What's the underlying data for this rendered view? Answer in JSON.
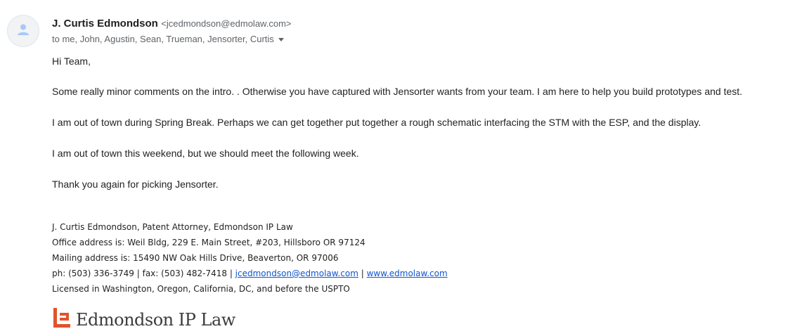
{
  "email": {
    "sender_name": "J. Curtis Edmondson",
    "sender_email": "<jcedmondson@edmolaw.com>",
    "recipients": "to me, John, Agustin, Sean, Trueman, Jensorter, Curtis",
    "body": {
      "greeting": "Hi Team,",
      "paragraphs": [
        "Some really minor comments on the intro. . Otherwise you have captured with Jensorter wants from your team.  I am here to help you build prototypes and test.",
        "I am out of town during Spring Break.  Perhaps we can get together put together a rough schematic interfacing the STM with the ESP, and the display.",
        "I am out of town this weekend, but we should meet the following week.",
        "Thank you again for picking Jensorter."
      ]
    },
    "signature": {
      "line1": "J. Curtis Edmondson, Patent Attorney, Edmondson IP Law",
      "line2": "Office address is: Weil Bldg, 229 E. Main Street, #203, Hillsboro OR 97124",
      "line3": "Mailing address is: 15490 NW Oak Hills Drive, Beaverton, OR 97006",
      "line4_prefix": "ph: (503) 336-3749 | fax: (503) 482-7418 | ",
      "email_link": "jcedmondson@edmolaw.com",
      "separator": " | ",
      "website_link": "www.edmolaw.com",
      "line5": "Licensed in Washington, Oregon, California, DC, and before the USPTO",
      "logo_text": "Edmondson IP Law"
    }
  },
  "colors": {
    "link": "#1155cc",
    "logo_accent": "#e2522c",
    "avatar_bg": "#f1f3f4",
    "avatar_icon": "#a8c7fa"
  },
  "icons": {
    "avatar": "person-icon",
    "recipients_toggle": "chevron-down-icon",
    "logo_mark": "edmondson-logo-icon"
  }
}
